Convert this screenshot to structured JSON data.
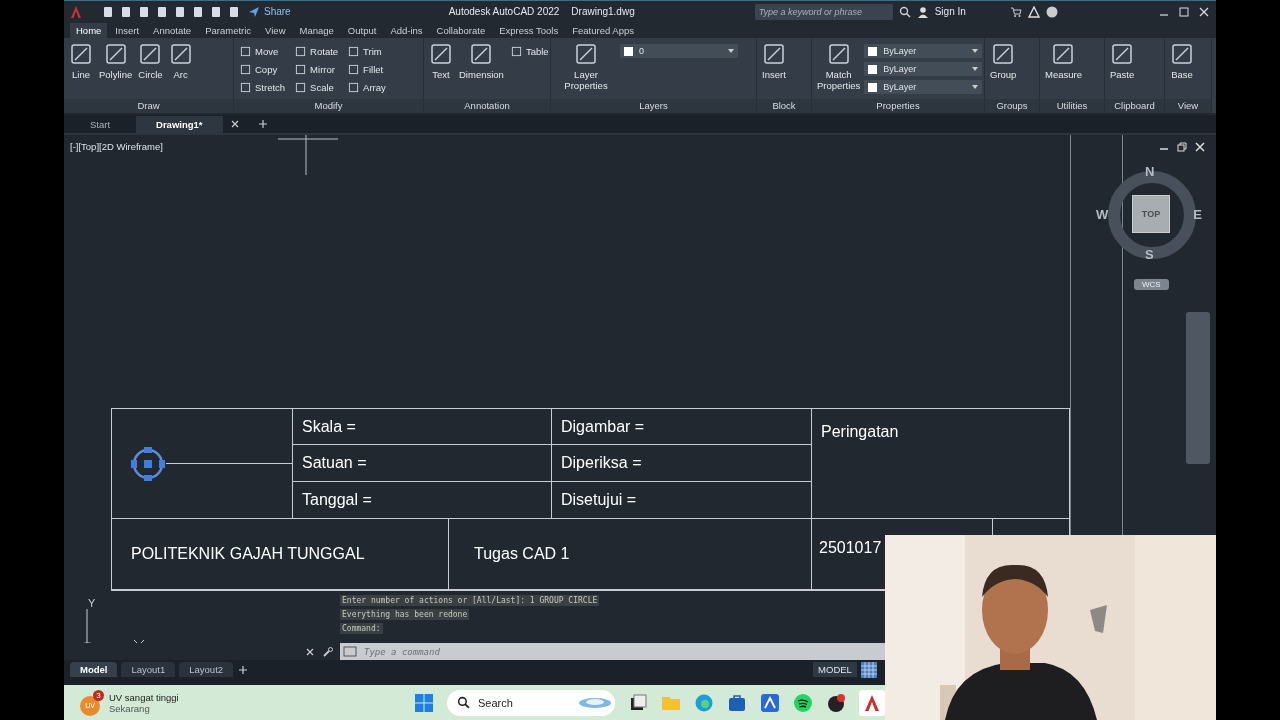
{
  "app": {
    "title": "Autodesk AutoCAD 2022",
    "file": "Drawing1.dwg",
    "share": "Share"
  },
  "search": {
    "placeholder": "Type a keyword or phrase"
  },
  "account": {
    "label": "Sign In"
  },
  "ribbon_tabs": [
    {
      "label": "Home",
      "selected": true
    },
    {
      "label": "Insert",
      "selected": false
    },
    {
      "label": "Annotate",
      "selected": false
    },
    {
      "label": "Parametric",
      "selected": false
    },
    {
      "label": "View",
      "selected": false
    },
    {
      "label": "Manage",
      "selected": false
    },
    {
      "label": "Output",
      "selected": false
    },
    {
      "label": "Add-ins",
      "selected": false
    },
    {
      "label": "Collaborate",
      "selected": false
    },
    {
      "label": "Express Tools",
      "selected": false
    },
    {
      "label": "Featured Apps",
      "selected": false
    }
  ],
  "panels": [
    {
      "title": "Draw",
      "tools": [
        {
          "kind": "big",
          "label": "Line"
        },
        {
          "kind": "big",
          "label": "Polyline"
        },
        {
          "kind": "big",
          "label": "Circle"
        },
        {
          "kind": "big",
          "label": "Arc"
        }
      ]
    },
    {
      "title": "Modify",
      "tools": [
        {
          "kind": "small",
          "label": "Move"
        },
        {
          "kind": "small",
          "label": "Copy"
        },
        {
          "kind": "small",
          "label": "Stretch"
        },
        {
          "kind": "small",
          "label": "Rotate"
        },
        {
          "kind": "small",
          "label": "Mirror"
        },
        {
          "kind": "small",
          "label": "Scale"
        },
        {
          "kind": "small",
          "label": "Trim"
        },
        {
          "kind": "small",
          "label": "Fillet"
        },
        {
          "kind": "small",
          "label": "Array"
        }
      ]
    },
    {
      "title": "Annotation",
      "tools": [
        {
          "kind": "big",
          "label": "Text"
        },
        {
          "kind": "big",
          "label": "Dimension"
        },
        {
          "kind": "small",
          "label": "Table"
        }
      ]
    },
    {
      "title": "Layers",
      "tools": [
        {
          "kind": "big",
          "label": "Layer Properties"
        },
        {
          "kind": "combo",
          "label": "0"
        }
      ]
    },
    {
      "title": "Block",
      "tools": [
        {
          "kind": "big",
          "label": "Insert"
        }
      ]
    },
    {
      "title": "Properties",
      "tools": [
        {
          "kind": "big",
          "label": "Match Properties"
        },
        {
          "kind": "combo",
          "label": "ByLayer"
        },
        {
          "kind": "combo",
          "label": "ByLayer"
        },
        {
          "kind": "combo",
          "label": "ByLayer"
        }
      ]
    },
    {
      "title": "Groups",
      "tools": [
        {
          "kind": "big",
          "label": "Group"
        }
      ]
    },
    {
      "title": "Utilities",
      "tools": [
        {
          "kind": "big",
          "label": "Measure"
        }
      ]
    },
    {
      "title": "Clipboard",
      "tools": [
        {
          "kind": "big",
          "label": "Paste"
        }
      ]
    },
    {
      "title": "View",
      "tools": [
        {
          "kind": "big",
          "label": "Base"
        }
      ]
    }
  ],
  "doc_tabs": [
    {
      "label": "Start",
      "selected": false
    },
    {
      "label": "Drawing1*",
      "selected": true
    }
  ],
  "viewport": {
    "label": "[-][Top][2D Wireframe]"
  },
  "viewcube": {
    "north": "N",
    "south": "S",
    "east": "E",
    "west": "W",
    "face": "TOP",
    "ucs": "WCS"
  },
  "title_block": {
    "upper": [
      [
        "Skala =",
        "Satuan =",
        "Tanggal ="
      ],
      [
        "Digambar =",
        "Diperiksa =",
        "Disetujui ="
      ]
    ],
    "note": "Peringatan",
    "school": "POLITEKNIK GAJAH TUNGGAL",
    "task": "Tugas CAD 1",
    "number": "2501017"
  },
  "ucs_axis": {
    "y": "Y"
  },
  "command_history": [
    "Enter number of actions or [All/Last]: 1 GROUP CIRCLE",
    "Everything has been redone",
    "Command:"
  ],
  "command_line": {
    "placeholder": "Type a command"
  },
  "layout_tabs": [
    {
      "label": "Model",
      "selected": true
    },
    {
      "label": "Layout1",
      "selected": false
    },
    {
      "label": "Layout2",
      "selected": false
    }
  ],
  "status_bar": {
    "space": "MODEL"
  },
  "taskbar": {
    "notification": {
      "badge": "3",
      "icon_text": "UV",
      "title": "UV sangat tinggi",
      "time": "Sekarang"
    },
    "search": "Search"
  },
  "webcam": {
    "kind": "picture"
  }
}
